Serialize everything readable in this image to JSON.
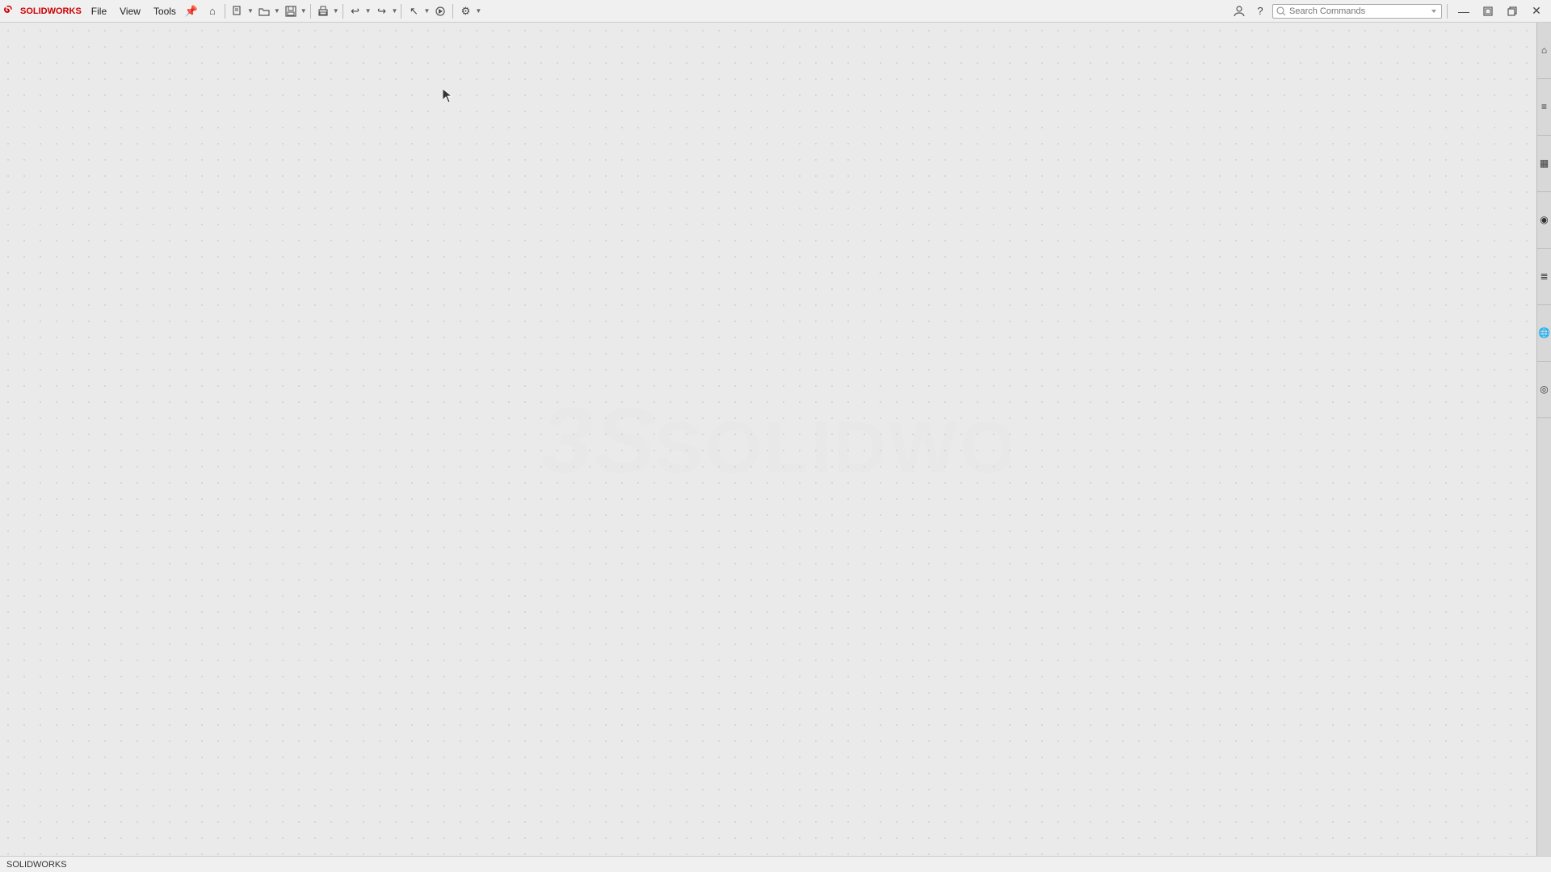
{
  "app": {
    "name": "SOLIDWORKS",
    "title": "SOLIDWORKS",
    "brand_color": "#cc0000"
  },
  "menubar": {
    "items": [
      {
        "id": "file",
        "label": "File"
      },
      {
        "id": "view",
        "label": "View"
      },
      {
        "id": "tools",
        "label": "Tools"
      }
    ]
  },
  "toolbar": {
    "groups": [
      {
        "id": "nav",
        "buttons": [
          {
            "id": "home",
            "icon": "⌂",
            "label": "Home"
          },
          {
            "id": "new",
            "icon": "☐",
            "label": "New",
            "has_dropdown": true
          },
          {
            "id": "open",
            "icon": "📂",
            "label": "Open",
            "has_dropdown": true
          },
          {
            "id": "save",
            "icon": "💾",
            "label": "Save",
            "has_dropdown": true
          }
        ]
      },
      {
        "id": "print",
        "buttons": [
          {
            "id": "print",
            "icon": "🖨",
            "label": "Print",
            "has_dropdown": true
          },
          {
            "id": "undo",
            "icon": "↩",
            "label": "Undo",
            "has_dropdown": true
          },
          {
            "id": "redo",
            "icon": "↪",
            "label": "Redo",
            "has_dropdown": true
          }
        ]
      },
      {
        "id": "select",
        "buttons": [
          {
            "id": "select",
            "icon": "↖",
            "label": "Select",
            "has_dropdown": true
          },
          {
            "id": "rebuild",
            "icon": "⚙",
            "label": "Rebuild"
          },
          {
            "id": "options",
            "icon": "☰",
            "label": "Options",
            "has_dropdown": true
          }
        ]
      }
    ]
  },
  "search": {
    "placeholder": "Search Commands",
    "value": ""
  },
  "right_sidebar": {
    "tabs": [
      {
        "id": "tab1",
        "icon": "⌂",
        "label": ""
      },
      {
        "id": "tab2",
        "icon": "≡",
        "label": ""
      },
      {
        "id": "tab3",
        "icon": "▦",
        "label": ""
      },
      {
        "id": "tab4",
        "icon": "◉",
        "label": ""
      },
      {
        "id": "tab5",
        "icon": "≣",
        "label": ""
      },
      {
        "id": "tab6",
        "icon": "🌐",
        "label": ""
      },
      {
        "id": "tab7",
        "icon": "◉",
        "label": ""
      }
    ]
  },
  "status_bar": {
    "text": "SOLIDWORKS"
  },
  "watermark": {
    "line1": "3S",
    "line2": "SOLIDWORKS"
  },
  "window_controls": {
    "minimize": "—",
    "maximize": "⊡",
    "restore": "❐",
    "close": "✕"
  }
}
